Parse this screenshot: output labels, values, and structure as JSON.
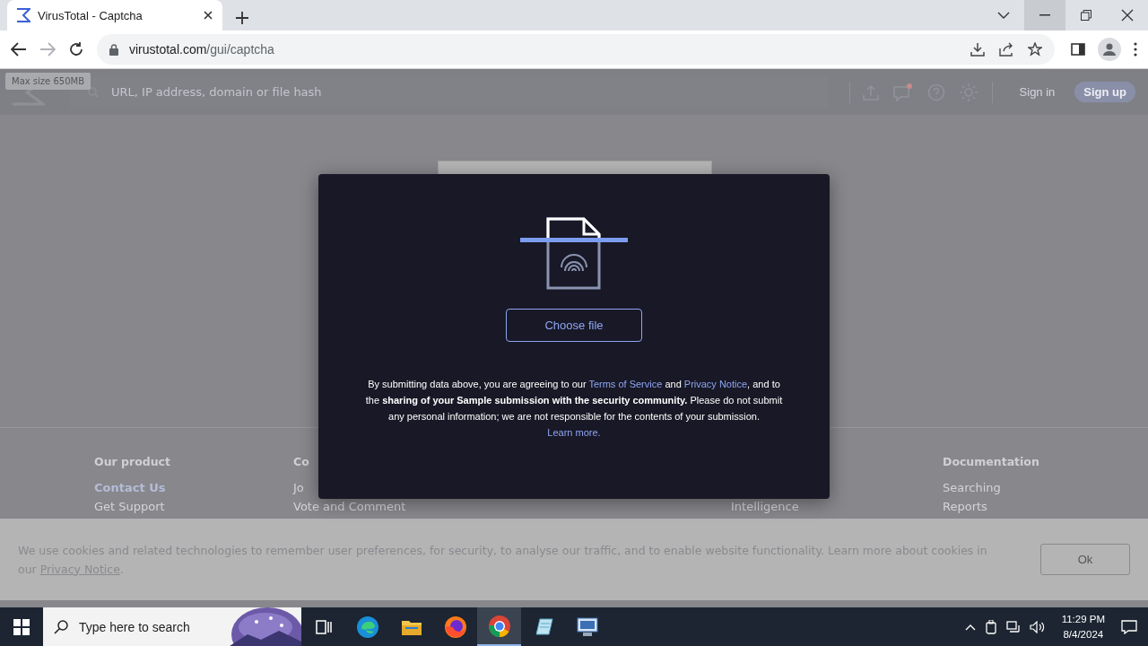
{
  "browser": {
    "tabs": [
      {
        "title": "VirusTotal - Captcha",
        "selected": true
      }
    ],
    "address": {
      "domain": "virustotal.com",
      "path": "/gui/captcha"
    },
    "forward_disabled": true
  },
  "header": {
    "tooltip": "Max size 650MB",
    "search_placeholder": "URL, IP address, domain or file hash",
    "notification_dot": true,
    "sign_in": "Sign in",
    "sign_up": "Sign up"
  },
  "footer": {
    "columns": [
      {
        "heading": "Our product",
        "links": [
          {
            "label": "Contact Us",
            "highlighted": true
          },
          {
            "label": "Get Support",
            "highlighted": false
          }
        ]
      },
      {
        "heading": "Co",
        "links": [
          {
            "label": "Jo",
            "highlighted": false
          },
          {
            "label": "Vote and Comment",
            "highlighted": false
          }
        ]
      },
      {
        "links": [
          {
            "label": "Intelligence",
            "highlighted": false
          }
        ]
      },
      {
        "heading": "Documentation",
        "links": [
          {
            "label": "Searching",
            "highlighted": false
          },
          {
            "label": "Reports",
            "highlighted": false
          }
        ]
      }
    ]
  },
  "modal": {
    "button": "Choose file",
    "notice": [
      {
        "kind": "plain",
        "text": "By submitting data above, you are agreeing to our "
      },
      {
        "kind": "link",
        "text": "Terms of Service"
      },
      {
        "kind": "plain",
        "text": " and "
      },
      {
        "kind": "link",
        "text": "Privacy Notice"
      },
      {
        "kind": "plain",
        "text": ", and to the "
      },
      {
        "kind": "bold",
        "text": "sharing of your Sample submission with the security community."
      },
      {
        "kind": "plain",
        "text": " Please do not submit any personal information; we are not responsible for the contents of your submission. "
      },
      {
        "kind": "link",
        "text": "Learn more."
      }
    ]
  },
  "cookie_banner": {
    "text": "We use cookies and related technologies to remember user preferences, for security, to analyse our traffic, and to enable website functionality. Learn more about cookies in our ",
    "link": "Privacy Notice",
    "suffix": ".",
    "button": "Ok"
  },
  "taskbar": {
    "search_placeholder": "Type here to search",
    "apps": [
      {
        "kind": "taskview",
        "selected": false
      },
      {
        "kind": "edge",
        "selected": false
      },
      {
        "kind": "explorer",
        "selected": false
      },
      {
        "kind": "firefox",
        "selected": false
      },
      {
        "kind": "chrome",
        "selected": true
      },
      {
        "kind": "notepad",
        "selected": false
      },
      {
        "kind": "network",
        "selected": false
      }
    ],
    "time": "11:29 PM",
    "date": "8/4/2024"
  }
}
